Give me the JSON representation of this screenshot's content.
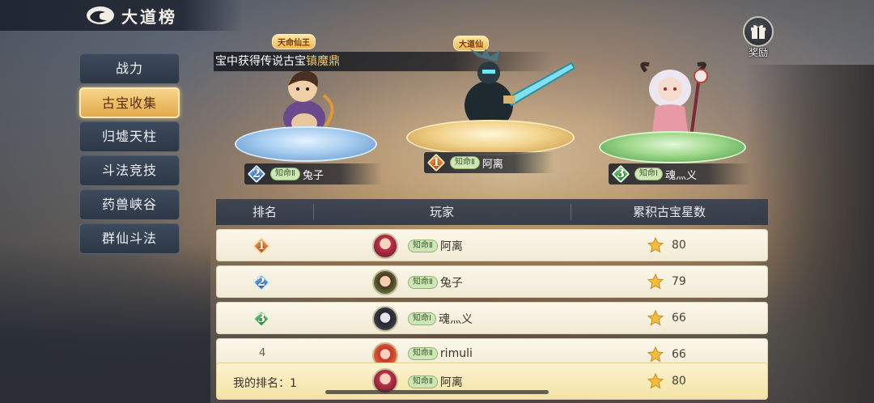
{
  "header": {
    "title": "大道榜"
  },
  "sidebar": {
    "items": [
      {
        "label": "战力"
      },
      {
        "label": "古宝收集"
      },
      {
        "label": "归墟天柱"
      },
      {
        "label": "斗法竞技"
      },
      {
        "label": "药兽峡谷"
      },
      {
        "label": "群仙斗法"
      }
    ],
    "active_index": 1
  },
  "reward": {
    "label": "奖励"
  },
  "notice": {
    "text": "宝中获得传说古宝",
    "highlight": "镇魔鼎"
  },
  "podium": {
    "first": {
      "rank": "1",
      "title_tag": "大道仙",
      "realm": "知命Ⅱ",
      "name": "阿离"
    },
    "second": {
      "rank": "2",
      "title_tag": "天命仙王",
      "realm": "知命Ⅱ",
      "name": "兔子"
    },
    "third": {
      "rank": "3",
      "realm": "知命Ⅰ",
      "name": "魂灬义"
    }
  },
  "table": {
    "headers": {
      "rank": "排名",
      "player": "玩家",
      "score": "累积古宝星数"
    },
    "rows": [
      {
        "rank": "1",
        "realm": "知命Ⅱ",
        "name": "阿离",
        "score": "80"
      },
      {
        "rank": "2",
        "realm": "知命Ⅱ",
        "name": "兔子",
        "score": "79"
      },
      {
        "rank": "3",
        "realm": "知命Ⅰ",
        "name": "魂灬义",
        "score": "66"
      },
      {
        "rank": "4",
        "realm": "知命Ⅱ",
        "name": "rimuli",
        "score": "66"
      }
    ]
  },
  "my_rank": {
    "label": "我的排名：",
    "rank": "1",
    "realm": "知命Ⅱ",
    "name": "阿离",
    "score": "80"
  },
  "colors": {
    "accent_gold": "#e3a94a",
    "rank1": "#c3501b",
    "rank2": "#2a6ac2",
    "rank3": "#2d8a3a"
  }
}
